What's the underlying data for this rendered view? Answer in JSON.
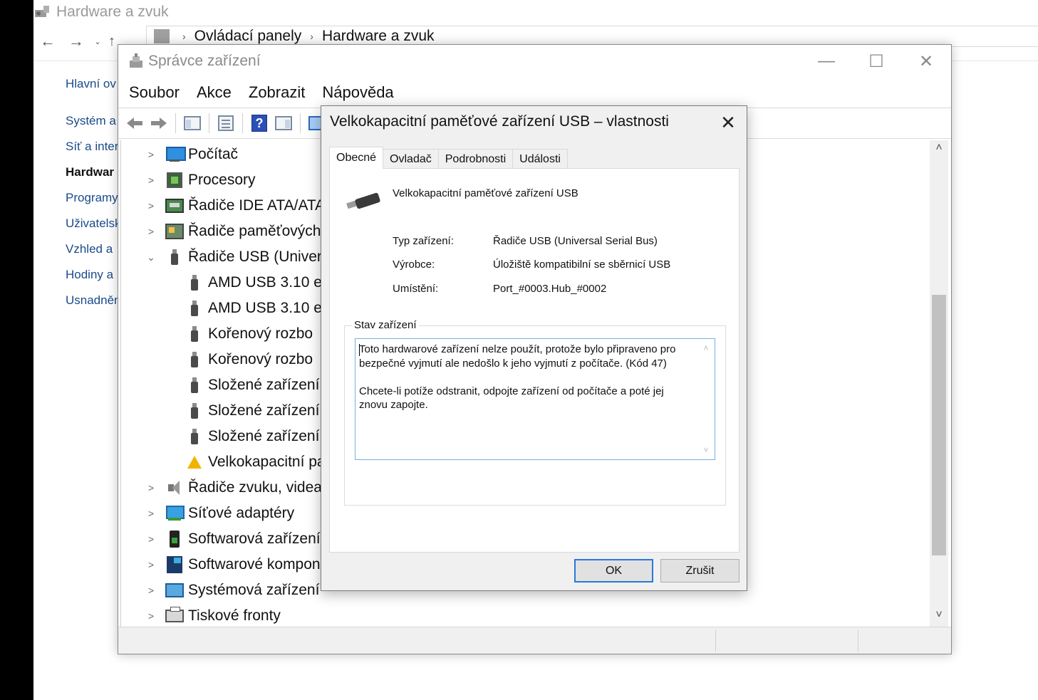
{
  "control_panel": {
    "title": "Hardware a zvuk",
    "nav": {
      "back": "←",
      "forward": "→",
      "dropdown": "⌄",
      "up": "↑"
    },
    "address": {
      "crumb1": "Ovládací panely",
      "crumb2": "Hardware a zvuk",
      "sep": "›"
    },
    "sidebar": [
      {
        "label": "Hlavní ov",
        "bold": false
      },
      {
        "label": "Systém a",
        "bold": false
      },
      {
        "label": "Síť a inter",
        "bold": false
      },
      {
        "label": "Hardwar",
        "bold": true
      },
      {
        "label": "Programy",
        "bold": false
      },
      {
        "label": "Uživatelsk",
        "bold": false
      },
      {
        "label": "Vzhled a",
        "bold": false
      },
      {
        "label": "Hodiny a",
        "bold": false
      },
      {
        "label": "Usnadněn",
        "bold": false
      }
    ]
  },
  "device_manager": {
    "title": "Správce zařízení",
    "window_controls": {
      "minimize": "—",
      "maximize": "☐",
      "close": "✕"
    },
    "menu": [
      "Soubor",
      "Akce",
      "Zobrazit",
      "Nápověda"
    ],
    "toolbar": {
      "help": "?"
    },
    "tree": [
      {
        "label": "Počítač",
        "expander": ">",
        "icon": "computer-icon",
        "level": 0
      },
      {
        "label": "Procesory",
        "expander": ">",
        "icon": "cpu-icon",
        "level": 0
      },
      {
        "label": "Řadiče IDE ATA/ATA",
        "expander": ">",
        "icon": "ide-controller-icon",
        "level": 0
      },
      {
        "label": "Řadiče paměťových",
        "expander": ">",
        "icon": "memory-controller-icon",
        "level": 0
      },
      {
        "label": "Řadiče USB (Univers",
        "expander": "⌄",
        "icon": "usb-icon",
        "level": 0
      },
      {
        "label": "AMD USB 3.10 e",
        "expander": "",
        "icon": "usb-icon",
        "level": 1
      },
      {
        "label": "AMD USB 3.10 e",
        "expander": "",
        "icon": "usb-icon",
        "level": 1
      },
      {
        "label": "Kořenový rozbo",
        "expander": "",
        "icon": "usb-icon",
        "level": 1
      },
      {
        "label": "Kořenový rozbo",
        "expander": "",
        "icon": "usb-icon",
        "level": 1
      },
      {
        "label": "Složené zařízení",
        "expander": "",
        "icon": "usb-icon",
        "level": 1
      },
      {
        "label": "Složené zařízení",
        "expander": "",
        "icon": "usb-icon",
        "level": 1
      },
      {
        "label": "Složené zařízení",
        "expander": "",
        "icon": "usb-icon",
        "level": 1
      },
      {
        "label": "Velkokapacitní pa",
        "expander": "",
        "icon": "warning-usb-icon",
        "level": 1
      },
      {
        "label": "Řadiče zvuku, videa",
        "expander": ">",
        "icon": "sound-icon",
        "level": 0
      },
      {
        "label": "Síťové adaptéry",
        "expander": ">",
        "icon": "network-adapter-icon",
        "level": 0
      },
      {
        "label": "Softwarová zařízení",
        "expander": ">",
        "icon": "software-device-icon",
        "level": 0
      },
      {
        "label": "Softwarové kompon",
        "expander": ">",
        "icon": "software-component-icon",
        "level": 0
      },
      {
        "label": "Systémová zařízení",
        "expander": ">",
        "icon": "system-device-icon",
        "level": 0
      },
      {
        "label": "Tiskové fronty",
        "expander": ">",
        "icon": "printer-icon",
        "level": 0
      }
    ],
    "scrollbar": {
      "up": "˄",
      "down": "˅"
    }
  },
  "dialog": {
    "title": "Velkokapacitní paměťové zařízení USB – vlastnosti",
    "close": "✕",
    "tabs": [
      "Obecné",
      "Ovladač",
      "Podrobnosti",
      "Události"
    ],
    "active_tab": "Obecné",
    "device_name": "Velkokapacitní paměťové zařízení USB",
    "properties": [
      {
        "label": "Typ zařízení:",
        "value": "Řadiče USB (Universal Serial Bus)"
      },
      {
        "label": "Výrobce:",
        "value": "Úložiště kompatibilní se sběrnicí USB"
      },
      {
        "label": "Umístění:",
        "value": "Port_#0003.Hub_#0002"
      }
    ],
    "status_legend": "Stav zařízení",
    "status_paragraph1": "Toto hardwarové zařízení nelze použít, protože bylo připraveno pro bezpečné vyjmutí ale nedošlo k jeho vyjmutí z počítače. (Kód 47)",
    "status_paragraph2": "Chcete-li potíže odstranit, odpojte zařízení od počítače a poté jej znovu zapojte.",
    "status_scroll": {
      "up": "˄",
      "down": "˅"
    },
    "ok_label": "OK",
    "cancel_label": "Zrušit"
  }
}
